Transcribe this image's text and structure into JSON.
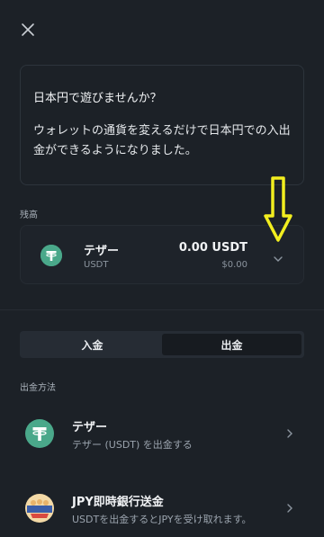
{
  "promo": {
    "title": "日本円で遊びませんか？",
    "body": "ウォレットの通貨を変えるだけで日本円での入出金ができるようになりました。"
  },
  "balance": {
    "section_label": "残高",
    "name": "テザー",
    "symbol": "USDT",
    "amount": "0.00 USDT",
    "fiat": "$0.00"
  },
  "tabs": [
    {
      "label": "入金",
      "active": false
    },
    {
      "label": "出金",
      "active": true
    }
  ],
  "methods_label": "出金方法",
  "methods": [
    {
      "title": "テザー",
      "desc": "テザー (USDT) を出金する"
    },
    {
      "title": "JPY即時銀行送金",
      "desc": "USDTを出金するとJPYを受け取れます。"
    }
  ],
  "colors": {
    "background": "#1c2127",
    "tether_green": "#4aa88a",
    "annotation_arrow": "#f2ee1f"
  }
}
